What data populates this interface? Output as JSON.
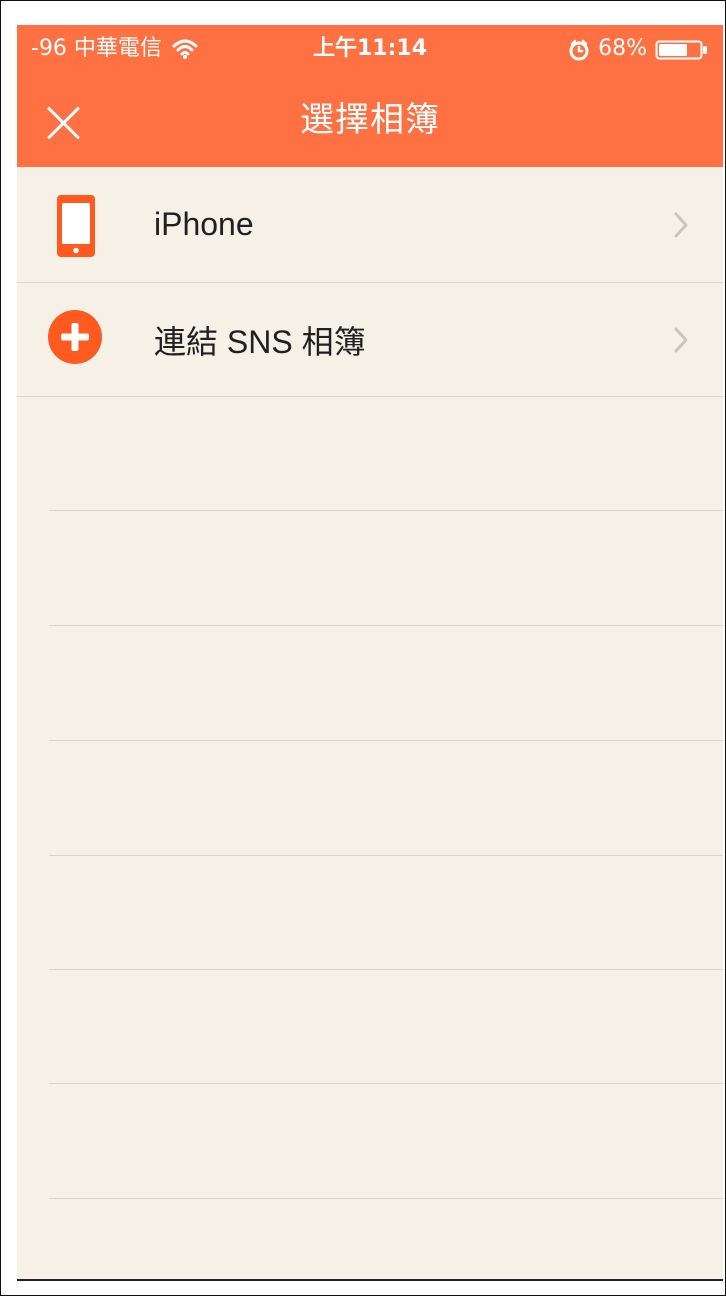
{
  "status_bar": {
    "carrier": "-96 中華電信",
    "time": "上午11:14",
    "battery": "68%"
  },
  "header": {
    "title": "選擇相簿"
  },
  "albums": [
    {
      "label": "iPhone",
      "icon": "phone-icon"
    },
    {
      "label": "連結 SNS 相簿",
      "icon": "add-circle-icon"
    }
  ],
  "colors": {
    "header_background": "#ff7043",
    "list_background": "#f5f1e7",
    "accent": "#ff5a1f",
    "separator": "#d8d5cf",
    "chevron": "#c9c6bf"
  }
}
